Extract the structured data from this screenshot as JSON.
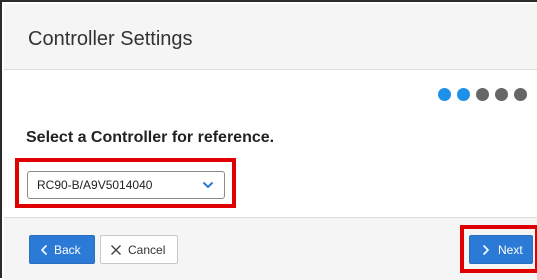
{
  "header": {
    "title": "Controller Settings"
  },
  "steps": {
    "total": 5,
    "active_indices": [
      0,
      1
    ],
    "active_color": "#1e90e8",
    "inactive_color": "#666666"
  },
  "main": {
    "prompt": "Select a Controller for reference.",
    "controller_select": {
      "value": "RC90-B/A9V5014040",
      "icon": "chevron-down-icon"
    }
  },
  "footer": {
    "back_label": "Back",
    "back_icon": "chevron-left-icon",
    "cancel_label": "Cancel",
    "cancel_icon": "close-icon",
    "next_label": "Next",
    "next_icon": "chevron-right-icon"
  },
  "colors": {
    "primary_button": "#2b7bd6",
    "highlight": "#e00000"
  }
}
